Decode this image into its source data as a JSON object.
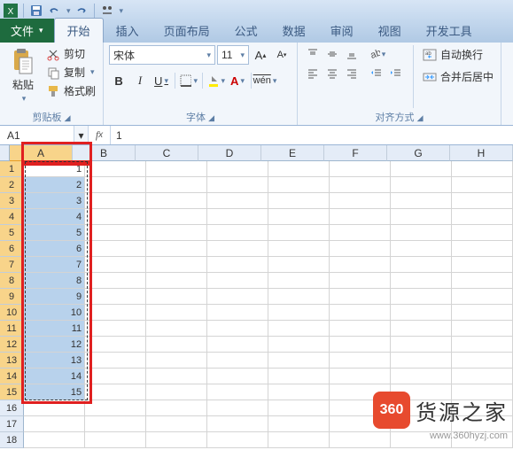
{
  "qat": {
    "save": "save-icon",
    "undo": "undo-icon",
    "redo": "redo-icon"
  },
  "tabs": {
    "file": "文件",
    "home": "开始",
    "insert": "插入",
    "page_layout": "页面布局",
    "formulas": "公式",
    "data": "数据",
    "review": "审阅",
    "view": "视图",
    "developer": "开发工具"
  },
  "clipboard": {
    "paste": "粘贴",
    "cut": "剪切",
    "copy": "复制",
    "format_painter": "格式刷",
    "group_label": "剪贴板"
  },
  "font": {
    "name": "宋体",
    "size": "11",
    "bold": "B",
    "italic": "I",
    "underline": "U",
    "group_label": "字体"
  },
  "alignment": {
    "wrap_text": "自动换行",
    "merge_center": "合并后居中",
    "group_label": "对齐方式"
  },
  "name_box": "A1",
  "formula_value": "1",
  "columns": [
    "A",
    "B",
    "C",
    "D",
    "E",
    "F",
    "G",
    "H"
  ],
  "row_count": 18,
  "selected_col_index": 0,
  "selected_rows": [
    1,
    15
  ],
  "active_cell": "A1",
  "cell_data": {
    "A1": "1",
    "A2": "2",
    "A3": "3",
    "A4": "4",
    "A5": "5",
    "A6": "6",
    "A7": "7",
    "A8": "8",
    "A9": "9",
    "A10": "10",
    "A11": "11",
    "A12": "12",
    "A13": "13",
    "A14": "14",
    "A15": "15"
  },
  "watermark": {
    "badge": "360",
    "text": "货源之家",
    "url": "www.360hyzj.com"
  }
}
